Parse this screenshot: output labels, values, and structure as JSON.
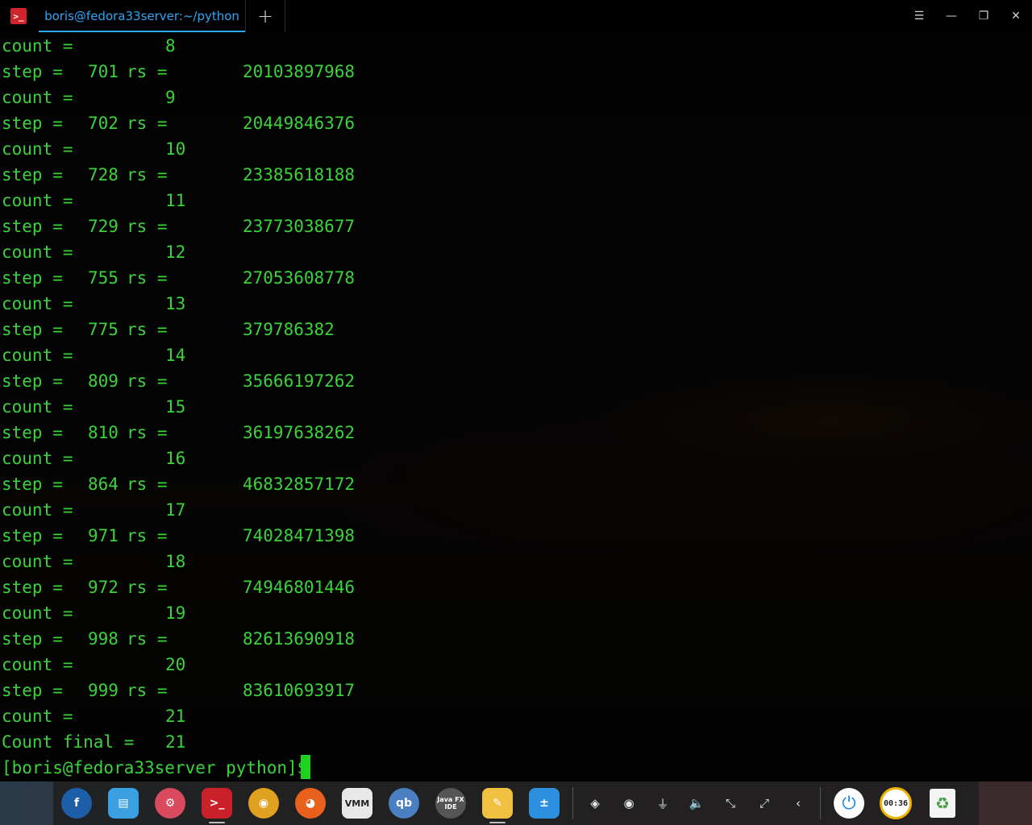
{
  "window": {
    "tab_title": "boris@fedora33server:~/python",
    "new_tab_glyph": "+",
    "app_icon_glyph": ">_",
    "controls": {
      "menu": "☰",
      "minimize": "—",
      "maximize": "❐",
      "close": "✕"
    }
  },
  "terminal": {
    "lines": [
      {
        "kind": "count",
        "label": "count =",
        "value": "8"
      },
      {
        "kind": "step",
        "label": "step =",
        "step": "701",
        "rs": "rs =",
        "value": "20103897968"
      },
      {
        "kind": "count",
        "label": "count =",
        "value": "9"
      },
      {
        "kind": "step",
        "label": "step =",
        "step": "702",
        "rs": "rs =",
        "value": "20449846376"
      },
      {
        "kind": "count",
        "label": "count =",
        "value": "10"
      },
      {
        "kind": "step",
        "label": "step =",
        "step": "728",
        "rs": "rs =",
        "value": "23385618188"
      },
      {
        "kind": "count",
        "label": "count =",
        "value": "11"
      },
      {
        "kind": "step",
        "label": "step =",
        "step": "729",
        "rs": "rs =",
        "value": "23773038677"
      },
      {
        "kind": "count",
        "label": "count =",
        "value": "12"
      },
      {
        "kind": "step",
        "label": "step =",
        "step": "755",
        "rs": "rs =",
        "value": "27053608778"
      },
      {
        "kind": "count",
        "label": "count =",
        "value": "13"
      },
      {
        "kind": "step",
        "label": "step =",
        "step": "775",
        "rs": "rs =",
        "value": "379786382"
      },
      {
        "kind": "count",
        "label": "count =",
        "value": "14"
      },
      {
        "kind": "step",
        "label": "step =",
        "step": "809",
        "rs": "rs =",
        "value": "35666197262"
      },
      {
        "kind": "count",
        "label": "count =",
        "value": "15"
      },
      {
        "kind": "step",
        "label": "step =",
        "step": "810",
        "rs": "rs =",
        "value": "36197638262"
      },
      {
        "kind": "count",
        "label": "count =",
        "value": "16"
      },
      {
        "kind": "step",
        "label": "step =",
        "step": "864",
        "rs": "rs =",
        "value": "46832857172"
      },
      {
        "kind": "count",
        "label": "count =",
        "value": "17"
      },
      {
        "kind": "step",
        "label": "step =",
        "step": "971",
        "rs": "rs =",
        "value": "74028471398"
      },
      {
        "kind": "count",
        "label": "count =",
        "value": "18"
      },
      {
        "kind": "step",
        "label": "step =",
        "step": "972",
        "rs": "rs =",
        "value": "74946801446"
      },
      {
        "kind": "count",
        "label": "count =",
        "value": "19"
      },
      {
        "kind": "step",
        "label": "step =",
        "step": "998",
        "rs": "rs =",
        "value": "82613690918"
      },
      {
        "kind": "count",
        "label": "count =",
        "value": "20"
      },
      {
        "kind": "step",
        "label": "step =",
        "step": "999",
        "rs": "rs =",
        "value": "83610693917"
      },
      {
        "kind": "count",
        "label": "count =",
        "value": "21"
      },
      {
        "kind": "final",
        "label": "Count final =",
        "value": "21"
      }
    ],
    "prompt": "[boris@fedora33server python]$ ",
    "text_color": "#3bd33b"
  },
  "dock": {
    "apps": [
      {
        "name": "fedora",
        "glyph": "f",
        "color": "#1c5fa8",
        "running": false
      },
      {
        "name": "file-manager",
        "glyph": "▤",
        "color": "#3aa0e0",
        "running": false
      },
      {
        "name": "settings",
        "glyph": "⚙",
        "color": "#d94a5e",
        "running": false
      },
      {
        "name": "terminal",
        "glyph": ">_",
        "color": "#c9202a",
        "running": true
      },
      {
        "name": "chrome",
        "glyph": "◉",
        "color": "#e0a020",
        "running": false
      },
      {
        "name": "firefox",
        "glyph": "◕",
        "color": "#e8601c",
        "running": false
      },
      {
        "name": "vmm",
        "glyph": "VMM",
        "color": "#8a8a8a",
        "running": false
      },
      {
        "name": "qbittorrent",
        "glyph": "qb",
        "color": "#4a7fc1",
        "running": false
      },
      {
        "name": "java-fx-ide",
        "glyph": "Java FX IDE",
        "color": "#555555",
        "running": false
      },
      {
        "name": "editor",
        "glyph": "✎",
        "color": "#f0c040",
        "running": true
      },
      {
        "name": "calculator",
        "glyph": "±",
        "color": "#2c8fe0",
        "running": false
      }
    ],
    "tray": [
      {
        "name": "cube",
        "glyph": "◈"
      },
      {
        "name": "monkey",
        "glyph": "◉"
      },
      {
        "name": "usb",
        "glyph": "⏚"
      },
      {
        "name": "volume",
        "glyph": "🔈"
      },
      {
        "name": "network-off",
        "glyph": "⤡"
      },
      {
        "name": "network",
        "glyph": "⤢"
      },
      {
        "name": "expand",
        "glyph": "‹"
      }
    ],
    "power_glyph": "⏻",
    "clock_text": "00:36",
    "trash_glyph": "♻"
  }
}
